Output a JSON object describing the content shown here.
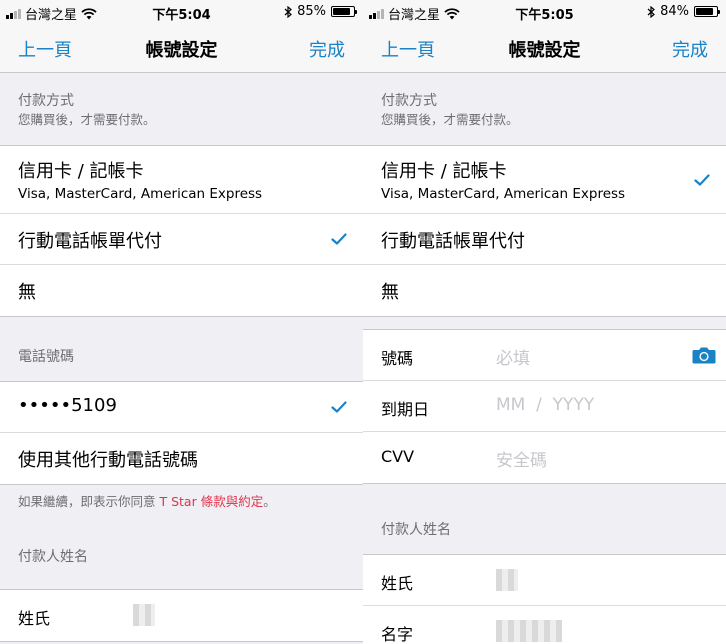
{
  "status_left": {
    "carrier": "台灣之星",
    "time": "下午5:04",
    "battery_text": "85%",
    "battery_level": 0.85
  },
  "status_right": {
    "carrier": "台灣之星",
    "time": "下午5:05",
    "battery_text": "84%",
    "battery_level": 0.84
  },
  "nav": {
    "back": "上一頁",
    "title": "帳號設定",
    "done": "完成"
  },
  "payment": {
    "header": "付款方式",
    "subheader": "您購買後，才需要付款。",
    "options": [
      {
        "title": "信用卡 / 記帳卡",
        "subtitle": "Visa, MasterCard, American Express"
      },
      {
        "title": "行動電話帳單代付"
      },
      {
        "title": "無"
      }
    ]
  },
  "phone": {
    "header": "電話號碼",
    "number": "•••••5109",
    "other": "使用其他行動電話號碼",
    "terms_prefix": "如果繼續，即表示你同意 ",
    "terms_link": "T Star 條款與約定",
    "terms_suffix": "。"
  },
  "card_form": {
    "number_label": "號碼",
    "number_placeholder": "必填",
    "expiry_label": "到期日",
    "expiry_placeholder": "MM  /  YYYY",
    "cvv_label": "CVV",
    "cvv_placeholder": "安全碼"
  },
  "payer": {
    "header": "付款人姓名",
    "last_name": "姓氏",
    "first_name": "名字"
  },
  "colors": {
    "accent": "#1a82c7",
    "link": "#e0334b",
    "background": "#efeff4"
  },
  "icons": [
    "signal-icon",
    "wifi-icon",
    "bluetooth-icon",
    "battery-icon",
    "checkmark-icon",
    "camera-icon"
  ]
}
